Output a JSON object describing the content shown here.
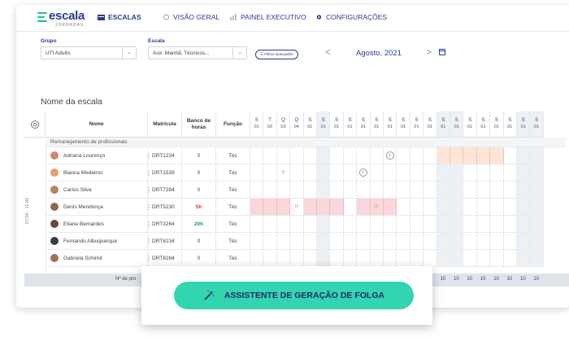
{
  "brand": {
    "name": "escala",
    "subtitle": "JORNADAS"
  },
  "nav": [
    {
      "label": "ESCALAS",
      "icon": "calendar-grid-icon",
      "active": true
    },
    {
      "label": "VISÃO GERAL",
      "icon": "circle-icon",
      "active": false
    },
    {
      "label": "PAINEL EXECUTIVO",
      "icon": "bar-chart-icon",
      "active": false
    },
    {
      "label": "CONFIGURAÇÕES",
      "icon": "gear-icon",
      "active": false
    }
  ],
  "filters": {
    "grupo_label": "Grupo",
    "grupo_value": "UTI Adulto",
    "escala_label": "Escala",
    "escala_value": "Aux. Manhã, Técnicos...",
    "advanced": "Filtros avançados"
  },
  "period": {
    "month": "Agosto, 2021",
    "prev": "<",
    "next": ">"
  },
  "schedule_title": "Nome da escala",
  "columns": {
    "nome": "Nome",
    "matricula": "Matrícula",
    "banco": "Banco de horas",
    "funcao": "Função"
  },
  "days": [
    {
      "w": "S",
      "d": "01"
    },
    {
      "w": "T",
      "d": "02"
    },
    {
      "w": "Q",
      "d": "03"
    },
    {
      "w": "Q",
      "d": "04"
    },
    {
      "w": "S",
      "d": "01"
    },
    {
      "w": "S",
      "d": "01"
    },
    {
      "w": "S",
      "d": "01"
    },
    {
      "w": "S",
      "d": "01"
    },
    {
      "w": "S",
      "d": "01"
    },
    {
      "w": "S",
      "d": "01"
    },
    {
      "w": "S",
      "d": "01"
    },
    {
      "w": "S",
      "d": "01"
    },
    {
      "w": "S",
      "d": "01"
    },
    {
      "w": "S",
      "d": "01"
    },
    {
      "w": "S",
      "d": "01"
    },
    {
      "w": "S",
      "d": "01"
    },
    {
      "w": "S",
      "d": "01"
    },
    {
      "w": "S",
      "d": "01"
    },
    {
      "w": "S",
      "d": "01"
    },
    {
      "w": "S",
      "d": "01"
    },
    {
      "w": "S",
      "d": "01"
    },
    {
      "w": "S",
      "d": "01"
    }
  ],
  "group_label": "Remanejamento de profissionais",
  "shift_label": "07:00 - 12:00",
  "rows": [
    {
      "name": "Adriana Lourenço",
      "matricula": "DRT1234",
      "banco": "0",
      "funcao": "Téc",
      "avatar": "#c98b6a"
    },
    {
      "name": "Bianca Medeiros",
      "matricula": "DRT1539",
      "banco": "0",
      "funcao": "Téc",
      "avatar": "#e0a06f"
    },
    {
      "name": "Carlos Silva",
      "matricula": "DRT7284",
      "banco": "0",
      "funcao": "Téc",
      "avatar": "#b9825f"
    },
    {
      "name": "Denis Mendonça",
      "matricula": "DRT5230",
      "banco": "5h",
      "funcao": "Téc",
      "avatar": "#8d6b57"
    },
    {
      "name": "Eliane Bernardes",
      "matricula": "DRT3264",
      "banco": "20h",
      "funcao": "Téc",
      "avatar": "#6a4a3c"
    },
    {
      "name": "Fernando Albuquerque",
      "matricula": "DRT6234",
      "banco": "0",
      "funcao": "Téc",
      "avatar": "#3d3d3d"
    },
    {
      "name": "Gabriela Schimit",
      "matricula": "DRT8284",
      "banco": "0",
      "funcao": "Téc",
      "avatar": "#a2705a"
    }
  ],
  "footer": {
    "label": "Nº de pro",
    "value": "10"
  },
  "cta": {
    "label": "ASSISTENTE DE GERAÇÃO DE FOLGA",
    "icon": "magic-wand-icon"
  },
  "colors": {
    "primary": "#2b3a8f",
    "accent": "#32d5b0",
    "pink": "#fad7dc",
    "peach": "#fde5d8"
  }
}
